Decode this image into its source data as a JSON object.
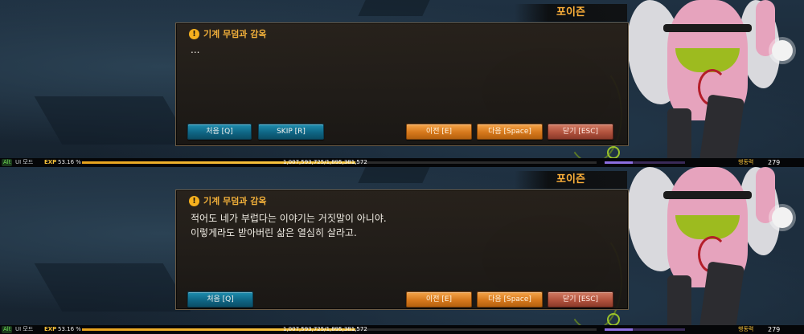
{
  "screens": [
    {
      "speaker": "포이즌",
      "dialog": {
        "title": "기계 무덤과 감옥",
        "text": "...",
        "buttons": {
          "first": "처음 [Q]",
          "skip": "SKIP [R]",
          "prev": "이전 [E]",
          "next": "다음 [Space]",
          "close": "닫기 [ESC]"
        }
      },
      "status": {
        "alt": "Alt",
        "ui_mode": "UI 모드",
        "exp_label": "EXP",
        "exp_percent": "53.16 %",
        "exp_fraction": 0.5316,
        "exp_readout": "1,007,593,725/1,895,381,572",
        "stat_label": "행동력",
        "stat_value": "279",
        "stat_fraction": 0.35
      }
    },
    {
      "speaker": "포이즌",
      "dialog": {
        "title": "기계 무덤과 감옥",
        "text": "적어도 네가 부럽다는 이야기는 거짓말이 아니야.\n이렇게라도 받아버린 삶은 열심히 살라고.",
        "buttons": {
          "first": "처음 [Q]",
          "prev": "이전 [E]",
          "next": "다음 [Space]",
          "close": "닫기 [ESC]"
        }
      },
      "status": {
        "alt": "Alt",
        "ui_mode": "UI 모드",
        "exp_label": "EXP",
        "exp_percent": "53.16 %",
        "exp_fraction": 0.5316,
        "exp_readout": "1,007,593,725/1,895,381,572",
        "stat_label": "행동력",
        "stat_value": "279",
        "stat_fraction": 0.35
      }
    }
  ],
  "colors": {
    "accent_gold": "#f2b03a",
    "button_teal": "#0f6685",
    "button_orange": "#d6781c",
    "button_red": "#b1523d"
  }
}
